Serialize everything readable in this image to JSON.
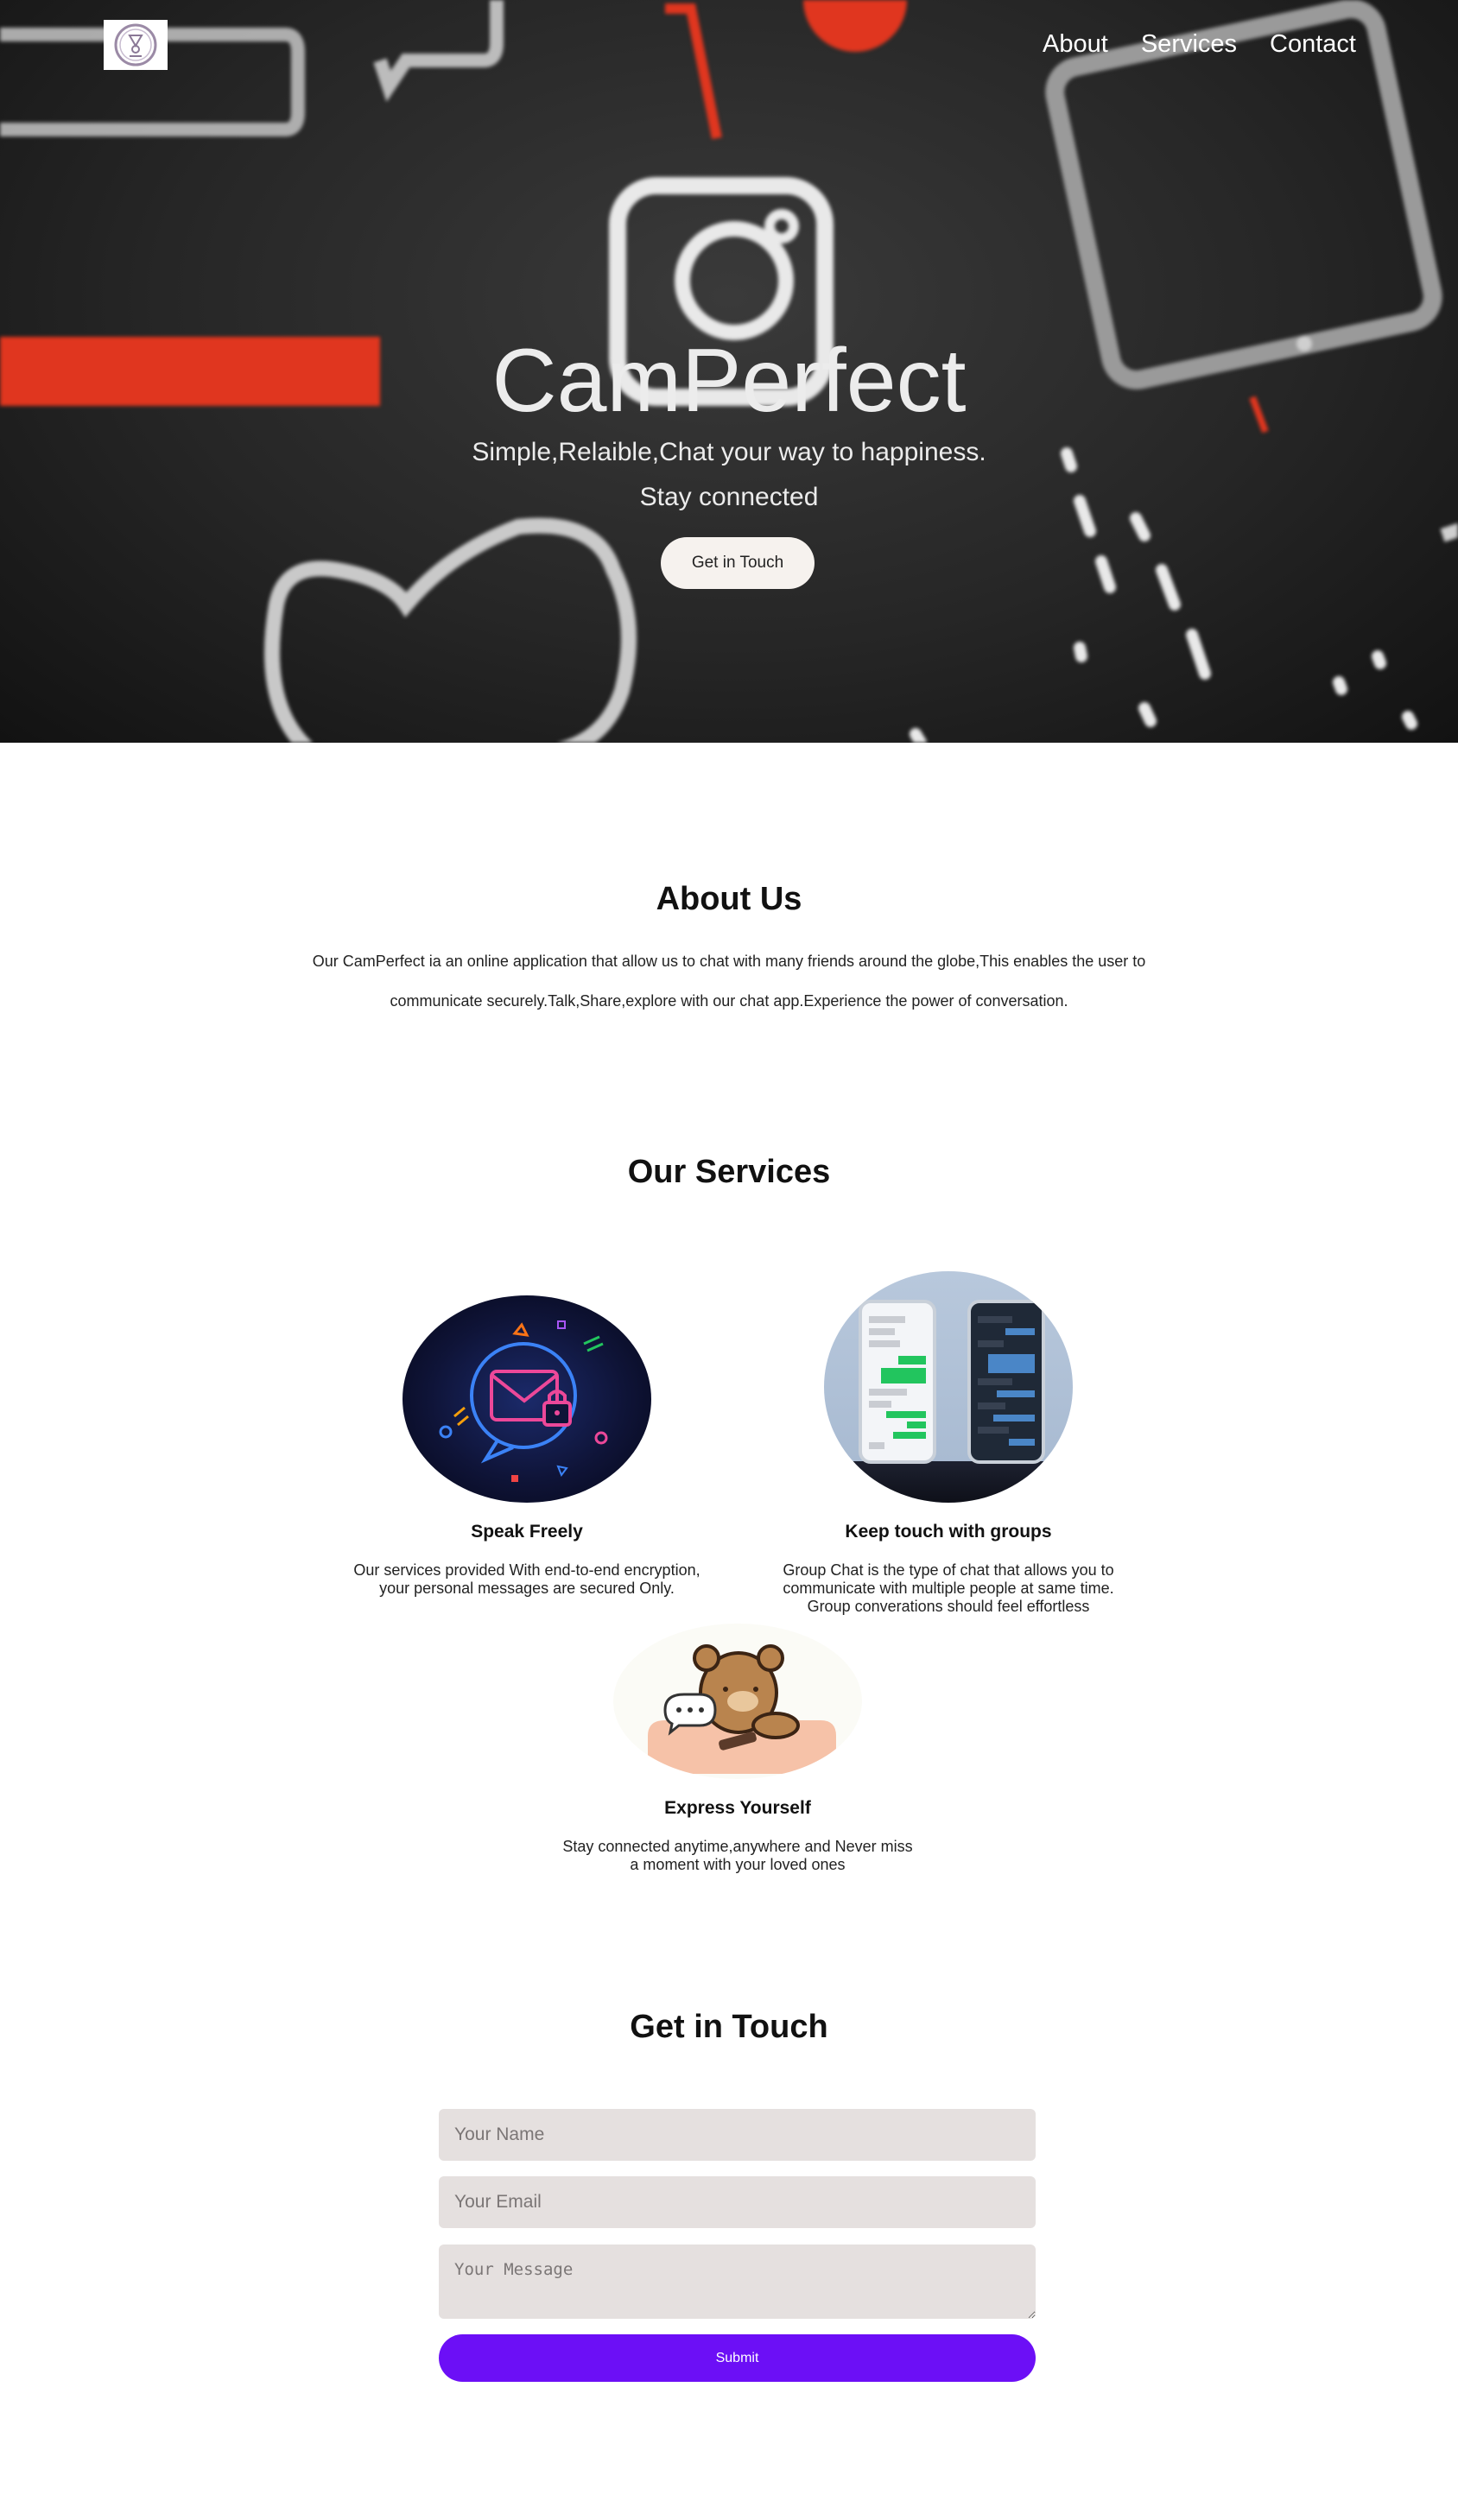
{
  "brand": {
    "logo_icon": "badge-logo-icon"
  },
  "nav": {
    "items": [
      {
        "label": "About"
      },
      {
        "label": "Services"
      },
      {
        "label": "Contact"
      }
    ]
  },
  "hero": {
    "title": "CamPerfect",
    "subtitle_1": "Simple,Relaible,Chat your way to happiness.",
    "subtitle_2": "Stay connected",
    "cta_label": "Get in Touch"
  },
  "about": {
    "title": "About Us",
    "text": "Our CamPerfect ia an online application that allow us to chat with many friends around the globe,This enables the user to communicate securely.Talk,Share,explore with our chat app.Experience the power of conversation."
  },
  "services": {
    "title": "Our Services",
    "items": [
      {
        "title": "Speak Freely",
        "text": "Our services provided With end-to-end encryption, your personal messages are secured Only.",
        "icon": "neon-lock-envelope-icon"
      },
      {
        "title": "Keep touch with groups",
        "text": "Group Chat is the type of chat that allows you to communicate with multiple people at same time. Group converations should feel effortless",
        "icon": "phone-chat-icon"
      },
      {
        "title": "Express Yourself",
        "text": "Stay connected anytime,anywhere and Never miss a moment with your loved ones",
        "icon": "bear-phone-icon"
      }
    ]
  },
  "contact": {
    "title": "Get in Touch",
    "name_placeholder": "Your Name",
    "email_placeholder": "Your Email",
    "message_placeholder": "Your Message",
    "submit_label": "Submit"
  },
  "colors": {
    "accent": "#6c0ff6",
    "hero_red": "#e0361f",
    "field_bg": "#e5e0df"
  }
}
